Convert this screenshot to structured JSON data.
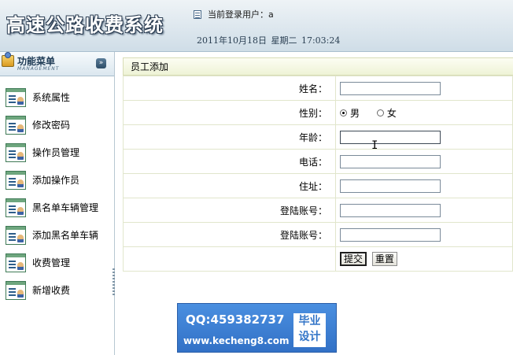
{
  "header": {
    "app_title": "高速公路收费系统",
    "current_user_label": "当前登录用户：a",
    "datetime": "2011年10月18日 星期二 17:03:24"
  },
  "sidebar": {
    "title": "功能菜单",
    "subtitle": "MANAGEMENT",
    "collapse_glyph": "»",
    "items": [
      {
        "label": "系统属性",
        "icon": "list-user-icon"
      },
      {
        "label": "修改密码",
        "icon": "list-user-icon"
      },
      {
        "label": "操作员管理",
        "icon": "list-user-icon"
      },
      {
        "label": "添加操作员",
        "icon": "list-user-icon"
      },
      {
        "label": "黑名单车辆管理",
        "icon": "list-user-icon"
      },
      {
        "label": "添加黑名单车辆",
        "icon": "list-user-icon"
      },
      {
        "label": "收费管理",
        "icon": "list-user-icon"
      },
      {
        "label": "新增收费",
        "icon": "list-user-icon"
      }
    ]
  },
  "form": {
    "panel_title": "员工添加",
    "fields": {
      "name": {
        "label": "姓名：",
        "value": ""
      },
      "gender": {
        "label": "性别：",
        "options": [
          "男",
          "女"
        ],
        "selected": "男"
      },
      "age": {
        "label": "年龄：",
        "value": ""
      },
      "phone": {
        "label": "电话：",
        "value": ""
      },
      "address": {
        "label": "住址：",
        "value": ""
      },
      "login_account": {
        "label": "登陆账号：",
        "value": ""
      },
      "login_account_2": {
        "label": "登陆账号：",
        "value": ""
      }
    },
    "buttons": {
      "submit": "提交",
      "reset": "重置"
    }
  },
  "watermark": {
    "qq": "QQ:459382737",
    "url": "www.kecheng8.com",
    "stamp_line1": "毕业",
    "stamp_line2": "设计"
  },
  "colors": {
    "header_bg": "#dde7ee",
    "panel_title_bg": "#eef3d6",
    "watermark_bg": "#3a7bd0"
  }
}
